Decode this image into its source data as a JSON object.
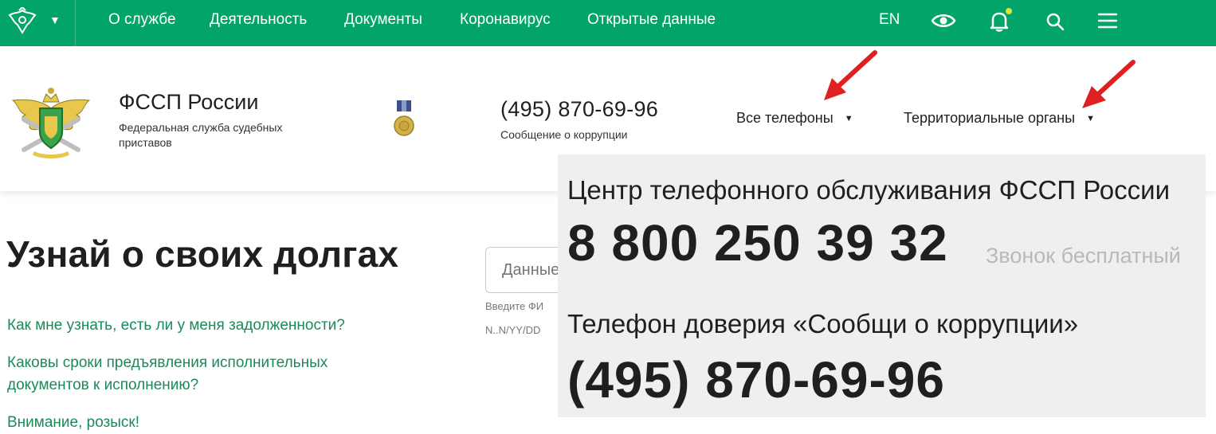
{
  "nav": {
    "links": [
      "О службе",
      "Деятельность",
      "Документы",
      "Коронавирус",
      "Открытые данные"
    ],
    "lang": "EN",
    "icons": [
      "eye-icon",
      "bell-icon",
      "search-icon",
      "menu-icon"
    ],
    "accent": "#03a469"
  },
  "header": {
    "org_name": "ФССП России",
    "org_subtitle": "Федеральная служба судебных приставов",
    "phone": "(495) 870-69-96",
    "phone_caption": "Сообщение о коррупции",
    "dropdowns": [
      "Все телефоны",
      "Территориальные органы"
    ]
  },
  "main": {
    "title": "Узнай о своих долгах",
    "search_placeholder": "Данные",
    "hint_line1": "Введите ФИ",
    "hint_line2": "N..N/YY/DD",
    "faq": [
      "Как мне узнать, есть ли у меня задолженности?",
      "Каковы сроки предъявления исполнительных документов к исполнению?",
      "Внимание, розыск!"
    ],
    "link_color": "#1b8a5a"
  },
  "panel": {
    "title": "Центр телефонного обслуживания ФССП России",
    "number": "8 800 250 39 32",
    "free_note": "Звонок бесплатный",
    "title2": "Телефон доверия «Сообщи о коррупции»",
    "number2": "(495) 870-69-96"
  },
  "arrow_color": "#e02020"
}
